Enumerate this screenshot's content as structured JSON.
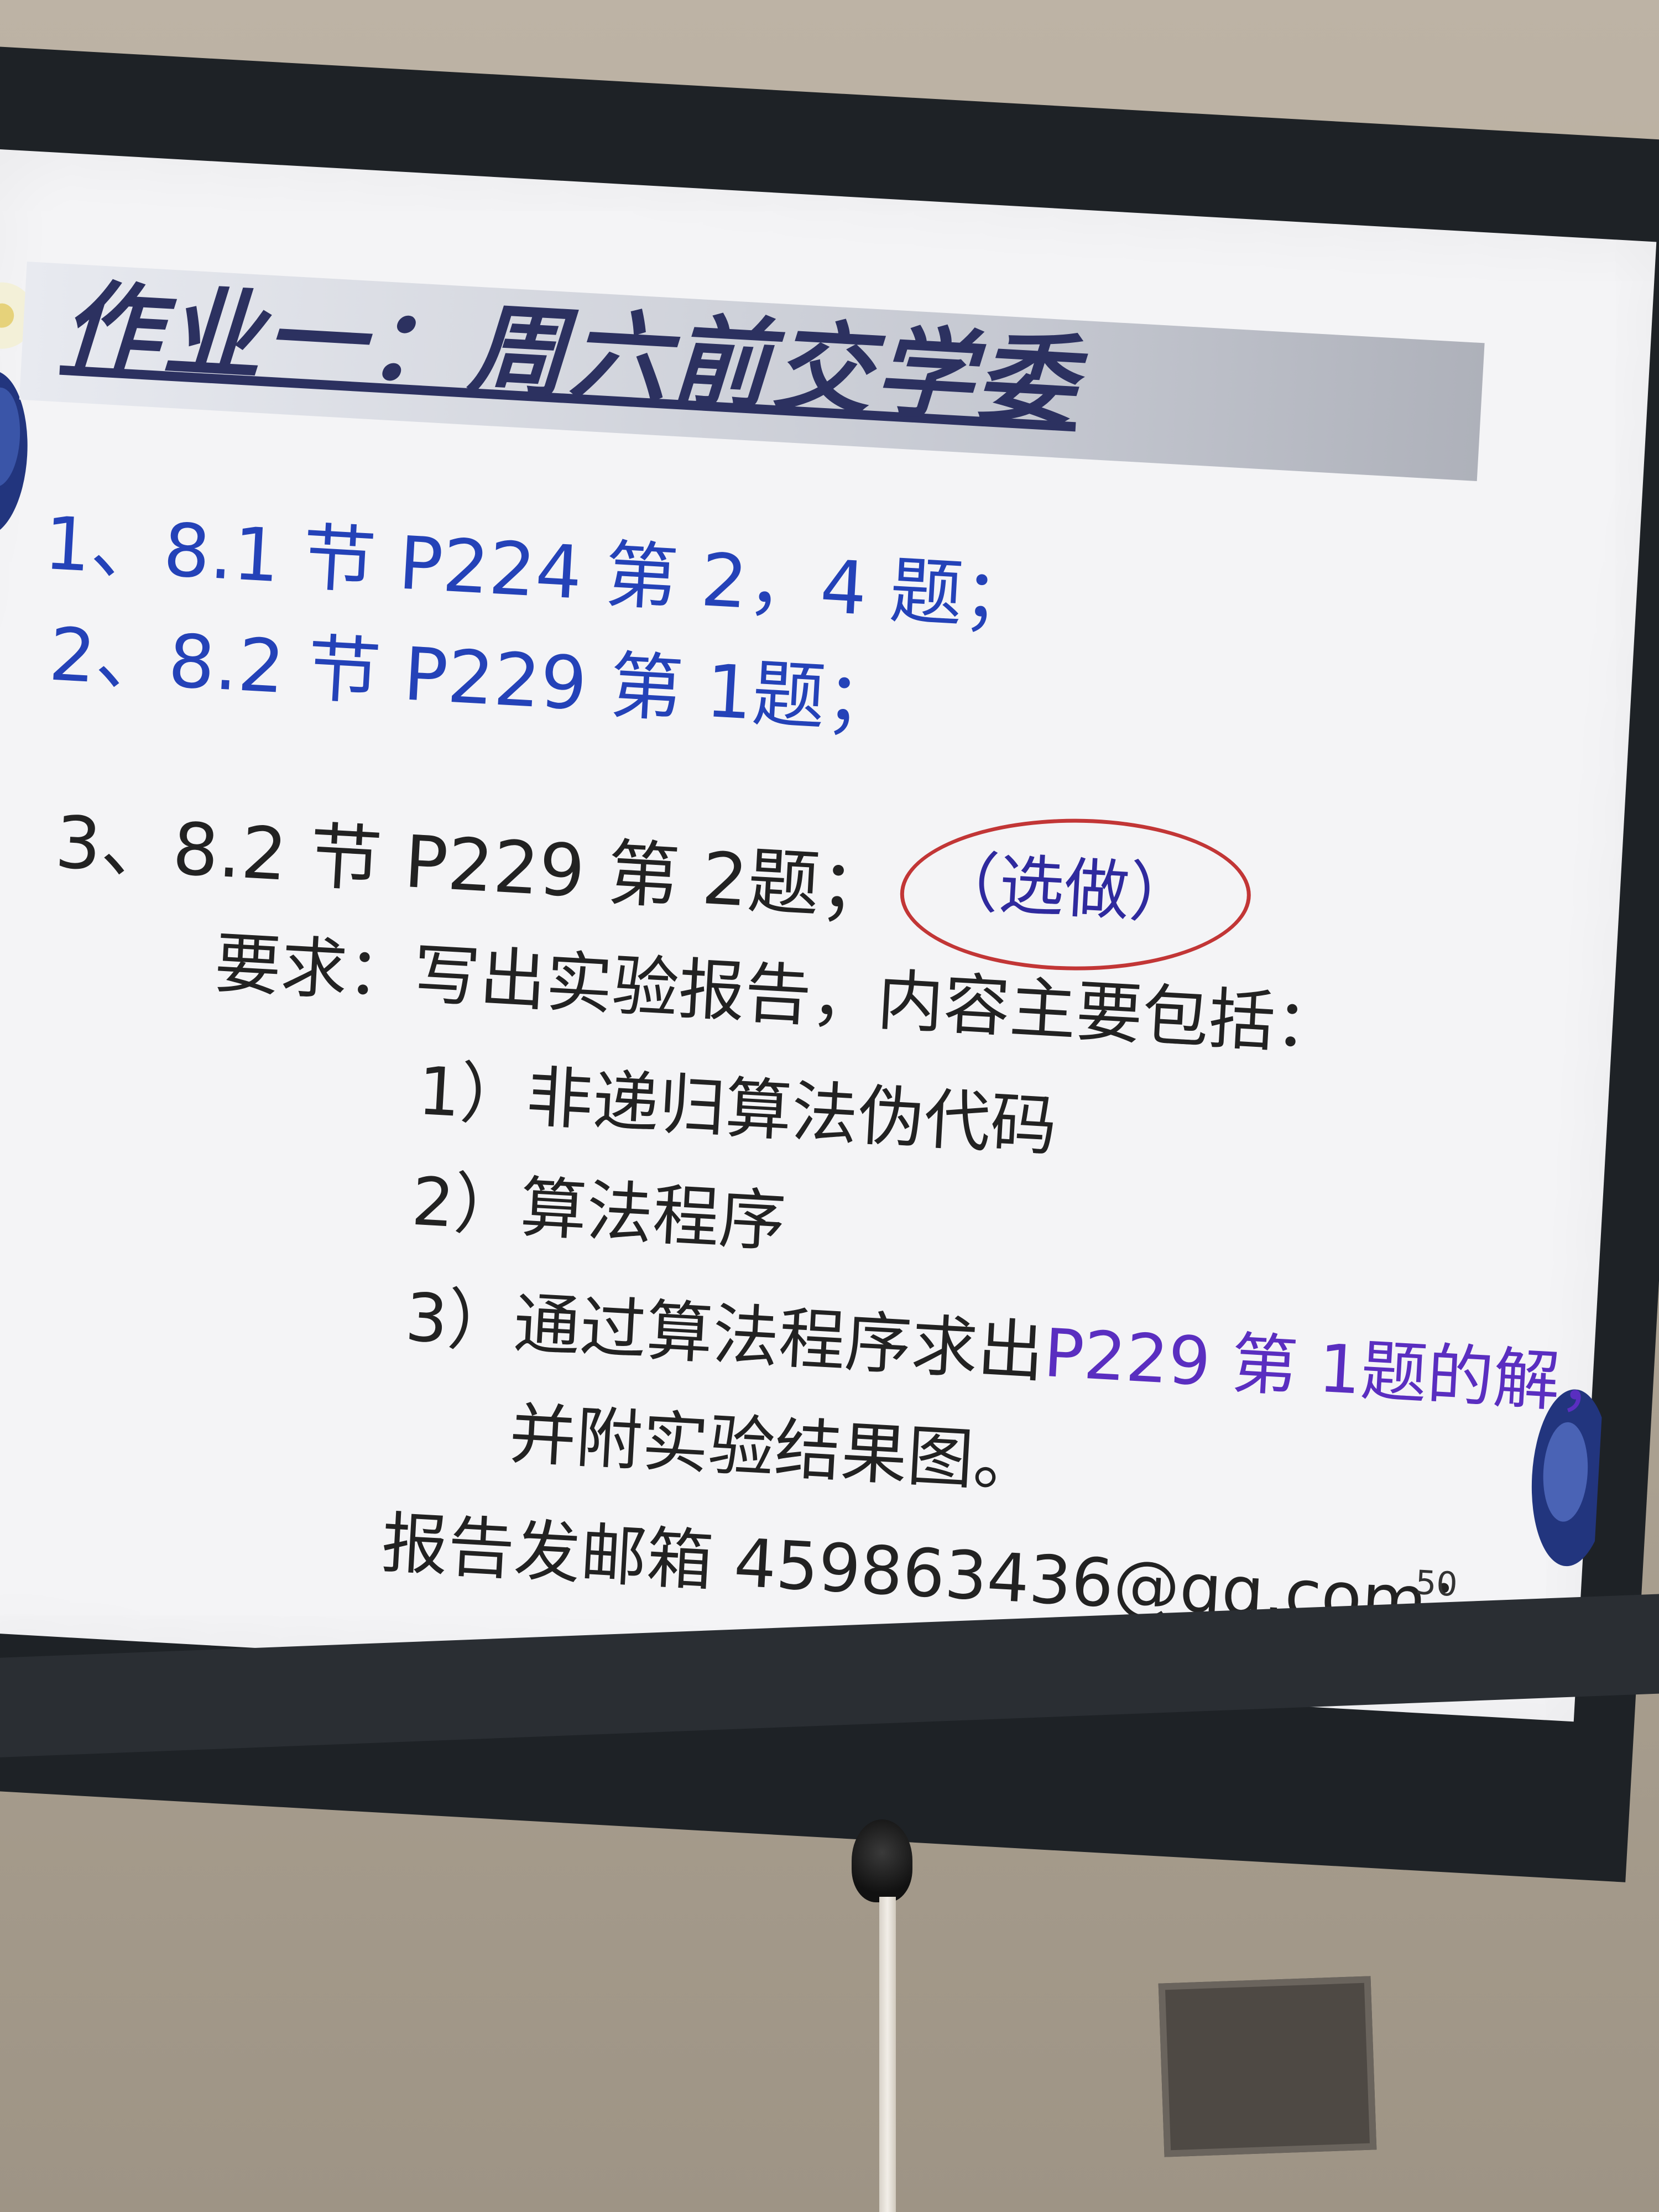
{
  "slide": {
    "title": "作业一：周六前交学委",
    "items": {
      "item1": "1、8.1 节 P224 第 2，4 题；",
      "item2": "2、8.2 节 P229 第 1题；",
      "item3": "3、8.2 节 P229 第 2题；",
      "item3_optional": "（选做）",
      "requirement": "要求：写出实验报告，内容主要包括：",
      "req1": "1）非递归算法伪代码",
      "req2": "2）算法程序",
      "req3_part1": "3）通过算法程序求出",
      "req3_part2": "P229 第 1题的解，",
      "req3_cont": "并附实验结果图。",
      "email_line": "报告发邮箱 459863436@qq.com；"
    },
    "page_number": "50"
  },
  "colors": {
    "title": "#2c3160",
    "item_blue": "#2442b8",
    "body_text": "#222222",
    "highlight_purple": "#5a2ec0",
    "annotation_red": "#c23636",
    "slide_background": "#f4f4f6",
    "screen_frame": "#1e2226",
    "wall": "#b3a999"
  },
  "icons": {
    "speaker": "speaker-icon",
    "flower_decoration": "flower-decoration-icon"
  }
}
